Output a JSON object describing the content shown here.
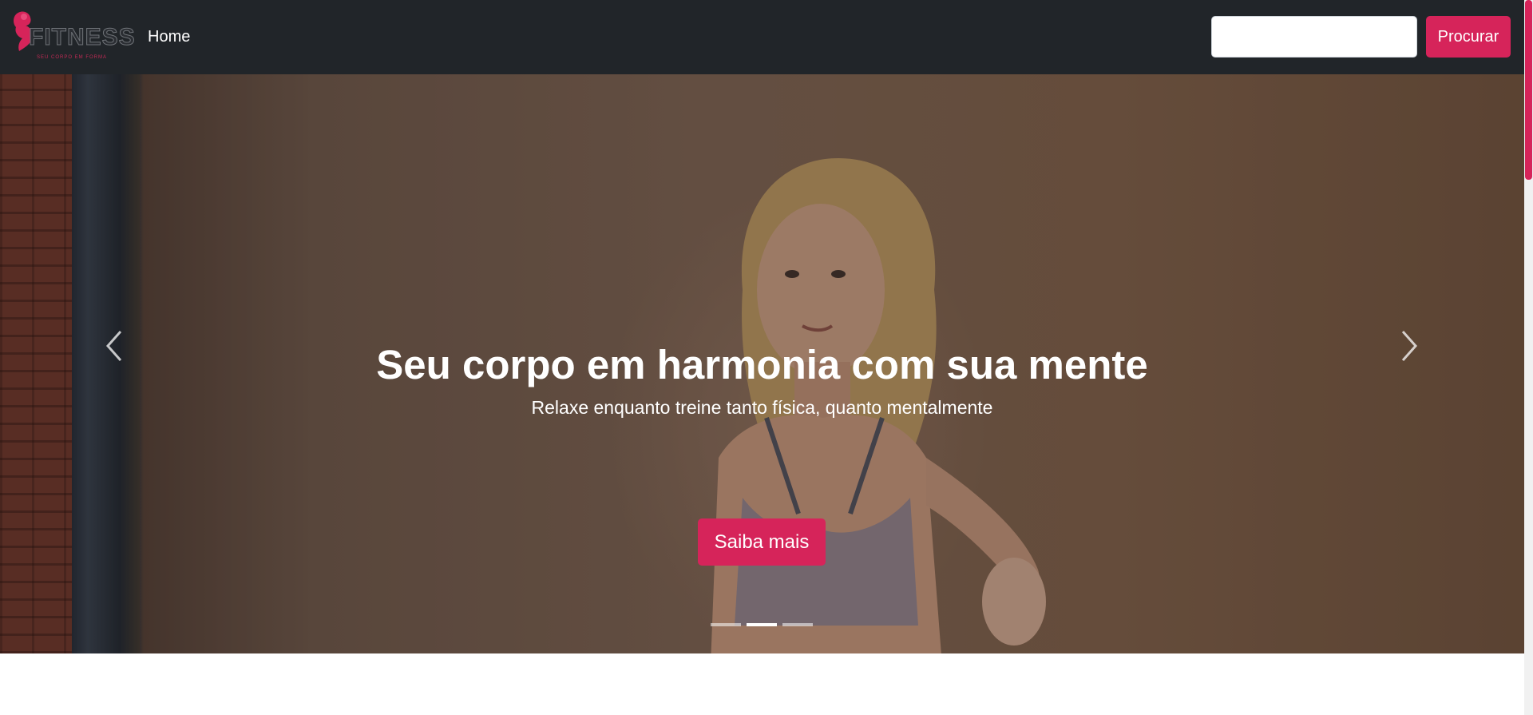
{
  "navbar": {
    "logo_text": "FITNESS",
    "logo_tagline": "SEU CORPO EM FORMA",
    "home_link": "Home",
    "search": {
      "placeholder": "",
      "value": ""
    },
    "search_button": "Procurar"
  },
  "hero": {
    "title": "Seu corpo em harmonia com sua mente",
    "subtitle": "Relaxe enquanto treine tanto física, quanto mentalmente",
    "cta_label": "Saiba mais",
    "slide_count": 3,
    "active_slide_index": 1
  },
  "colors": {
    "navbar_bg": "#212529",
    "accent": "#d6245a",
    "text_on_dark": "#ffffff"
  },
  "icons": {
    "prev": "chevron-left-icon",
    "next": "chevron-right-icon"
  }
}
